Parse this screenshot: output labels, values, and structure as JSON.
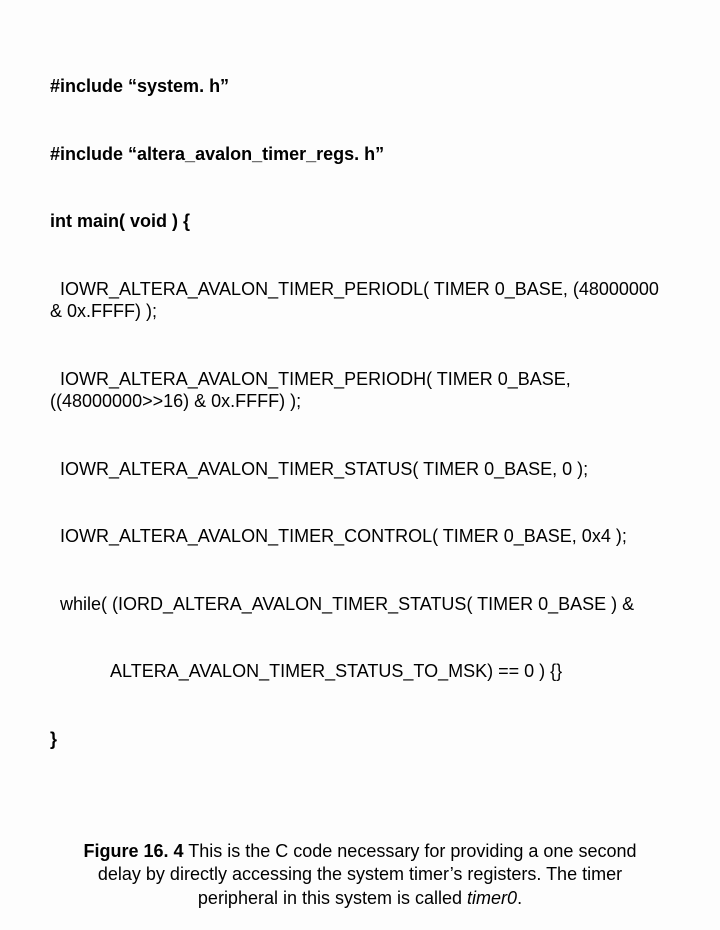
{
  "code": {
    "lines": [
      {
        "bold": true,
        "text": "#include “system. h”"
      },
      {
        "bold": true,
        "text": "#include “altera_avalon_timer_regs. h”"
      },
      {
        "bold": true,
        "text": "int main( void ) {"
      },
      {
        "bold": false,
        "text": "  IOWR_ALTERA_AVALON_TIMER_PERIODL( TIMER 0_BASE, (48000000 & 0x.FFFF) );"
      },
      {
        "bold": false,
        "text": "  IOWR_ALTERA_AVALON_TIMER_PERIODH( TIMER 0_BASE, ((48000000>>16) & 0x.FFFF) );"
      },
      {
        "bold": false,
        "text": "  IOWR_ALTERA_AVALON_TIMER_STATUS( TIMER 0_BASE, 0 );"
      },
      {
        "bold": false,
        "text": "  IOWR_ALTERA_AVALON_TIMER_CONTROL( TIMER 0_BASE, 0x4 );"
      },
      {
        "bold": false,
        "text": "  while( (IORD_ALTERA_AVALON_TIMER_STATUS( TIMER 0_BASE ) &"
      },
      {
        "bold": false,
        "text": "            ALTERA_AVALON_TIMER_STATUS_TO_MSK) == 0 ) {}"
      },
      {
        "bold": true,
        "text": "}"
      }
    ]
  },
  "caption": {
    "label": "Figure 16. 4",
    "body": " This is the C code necessary for providing a one second delay by directly accessing the system timer’s registers. The timer peripheral in this system is called ",
    "timer_name": "timer0",
    "trailing": "."
  }
}
